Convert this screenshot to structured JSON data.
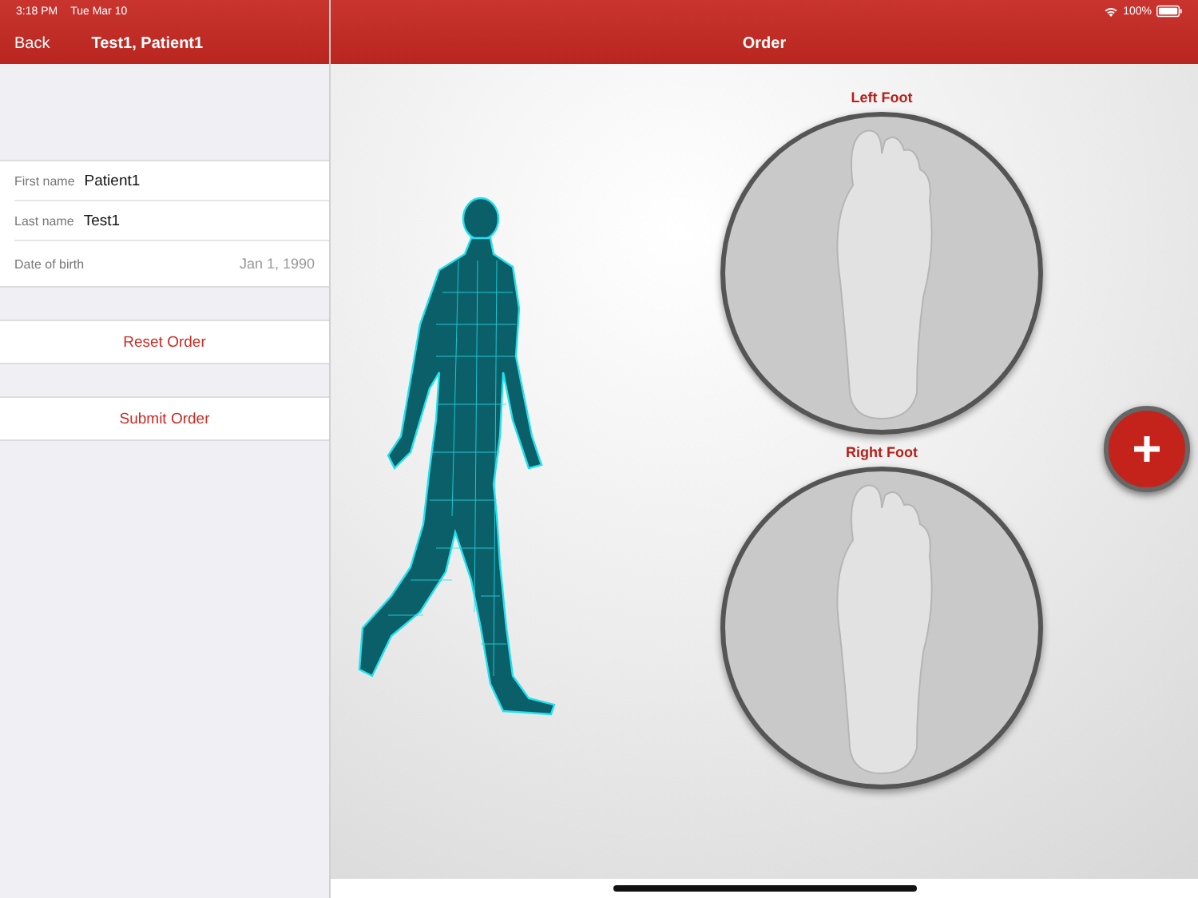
{
  "status_bar": {
    "time": "3:18 PM",
    "date": "Tue Mar 10",
    "battery": "100%"
  },
  "nav_left": {
    "back": "Back",
    "title": "Test1, Patient1"
  },
  "nav_right": {
    "title": "Order"
  },
  "patient_fields": [
    {
      "label": "First name",
      "value": "Patient1",
      "kind": "inline"
    },
    {
      "label": "Last name",
      "value": "Test1",
      "kind": "inline"
    },
    {
      "label": "Date of birth",
      "value": "Jan 1, 1990",
      "kind": "detail"
    }
  ],
  "actions": [
    "Reset Order",
    "Submit Order"
  ],
  "feet": [
    {
      "label": "Left Foot"
    },
    {
      "label": "Right Foot"
    }
  ]
}
